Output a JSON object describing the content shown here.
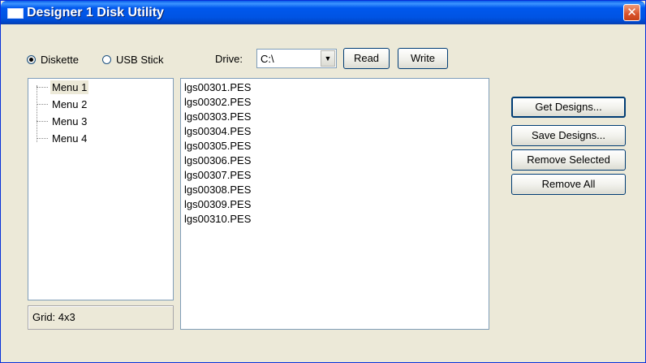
{
  "window": {
    "title": "Designer 1 Disk Utility"
  },
  "source": {
    "options": [
      {
        "label": "Diskette",
        "checked": true
      },
      {
        "label": "USB Stick",
        "checked": false
      }
    ]
  },
  "drive": {
    "label": "Drive:",
    "value": "C:\\"
  },
  "toolbar": {
    "read_label": "Read",
    "write_label": "Write"
  },
  "tree": {
    "items": [
      "Menu 1",
      "Menu 2",
      "Menu 3",
      "Menu 4"
    ],
    "selected": "Menu 1"
  },
  "files": [
    "lgs00301.PES",
    "lgs00302.PES",
    "lgs00303.PES",
    "lgs00304.PES",
    "lgs00305.PES",
    "lgs00306.PES",
    "lgs00307.PES",
    "lgs00308.PES",
    "lgs00309.PES",
    "lgs00310.PES"
  ],
  "actions": {
    "get_designs": "Get Designs...",
    "save_designs": "Save Designs...",
    "remove_selected": "Remove Selected",
    "remove_all": "Remove All"
  },
  "status": {
    "grid": "Grid: 4x3"
  },
  "colors": {
    "titlebar": "#0054e3",
    "dialog_bg": "#ece9d8",
    "close_button": "#d8522b"
  }
}
